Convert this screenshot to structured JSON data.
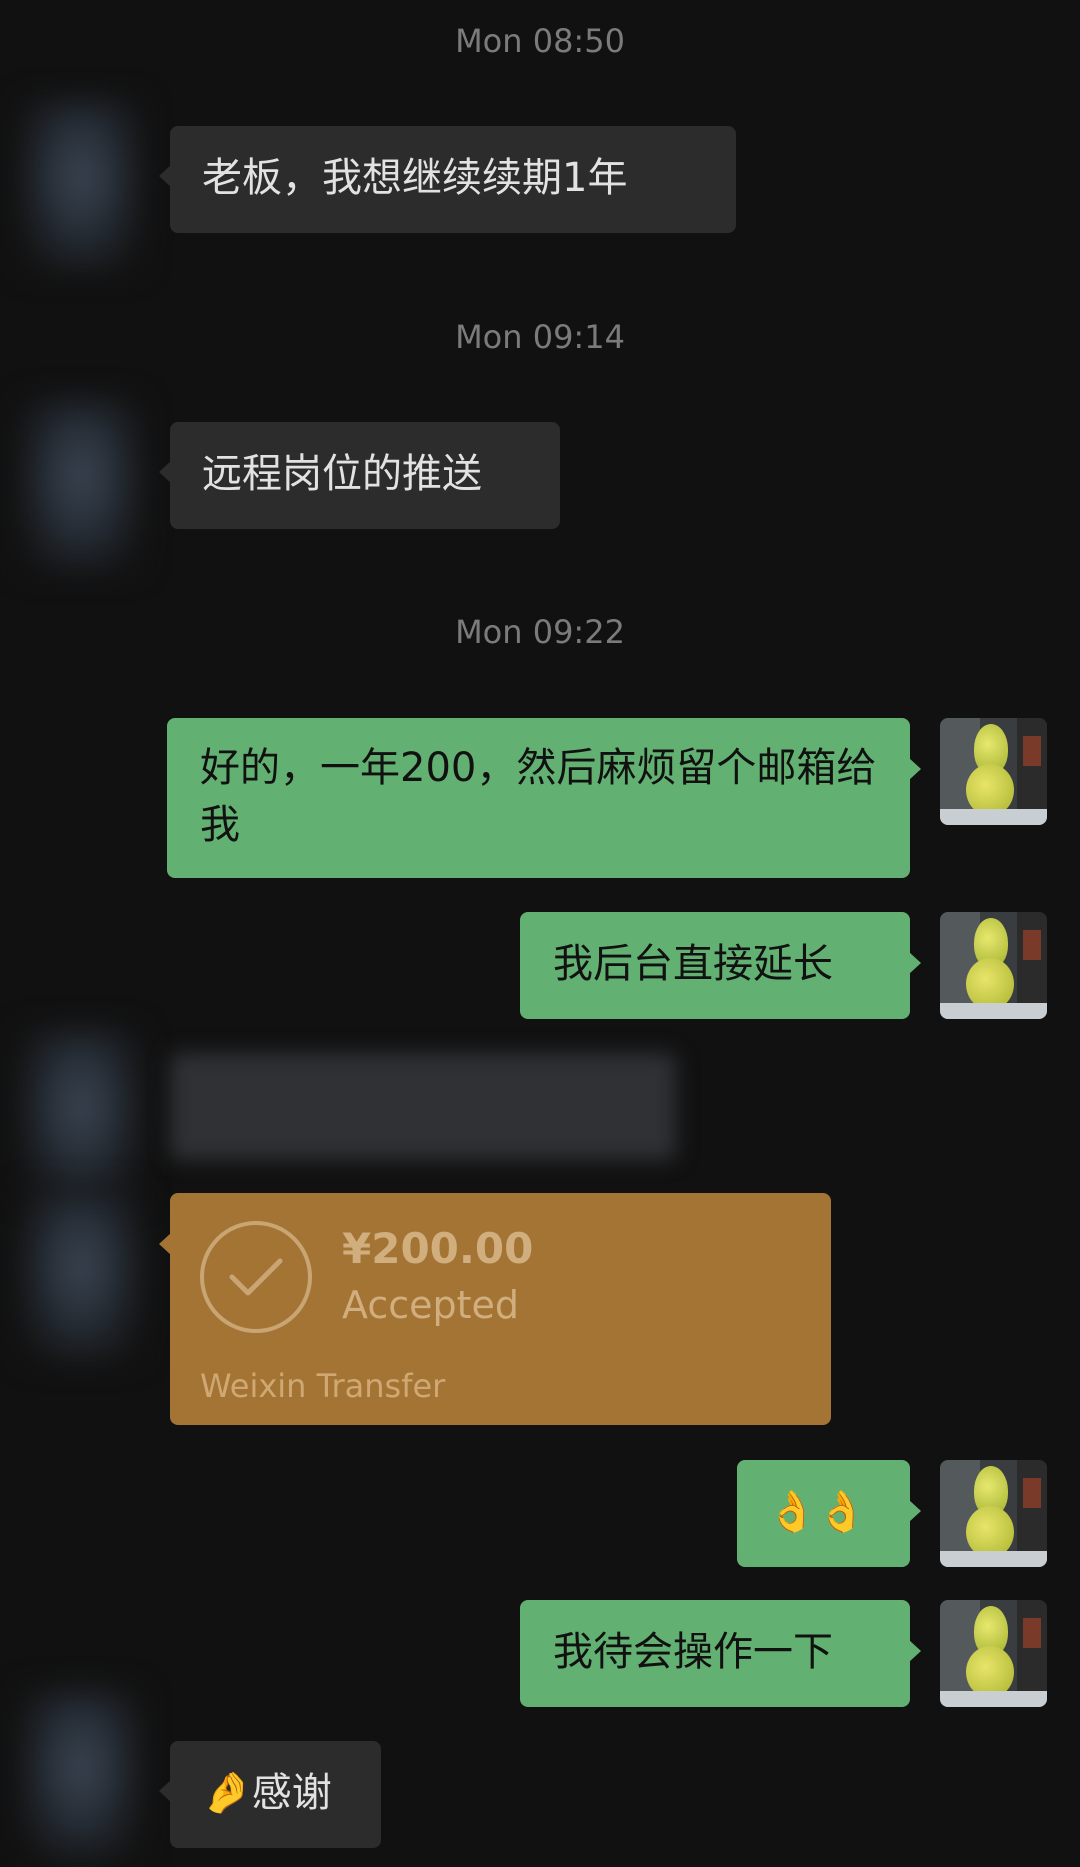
{
  "timestamps": [
    "Mon 08:50",
    "Mon 09:14",
    "Mon 09:22"
  ],
  "messages": [
    {
      "sender": "other",
      "text": "老板，我想继续续期1年"
    },
    {
      "sender": "other",
      "text": "远程岗位的推送"
    },
    {
      "sender": "self",
      "text": "好的，一年200，然后麻烦留个邮箱给我"
    },
    {
      "sender": "self",
      "text": "我后台直接延长"
    },
    {
      "sender": "self",
      "text": "👌👌"
    },
    {
      "sender": "self",
      "text": "我待会操作一下"
    },
    {
      "sender": "other",
      "text": "🤌感谢"
    }
  ],
  "transfer": {
    "amount": "¥200.00",
    "status": "Accepted",
    "source": "Weixin Transfer"
  },
  "colors": {
    "background": "#111111",
    "incoming_bubble": "#2c2c2c",
    "outgoing_bubble": "#63b172",
    "transfer_card": "#a47435",
    "timestamp": "#7b7b7b"
  },
  "icons": {
    "transfer_status": "check-circle-icon"
  }
}
